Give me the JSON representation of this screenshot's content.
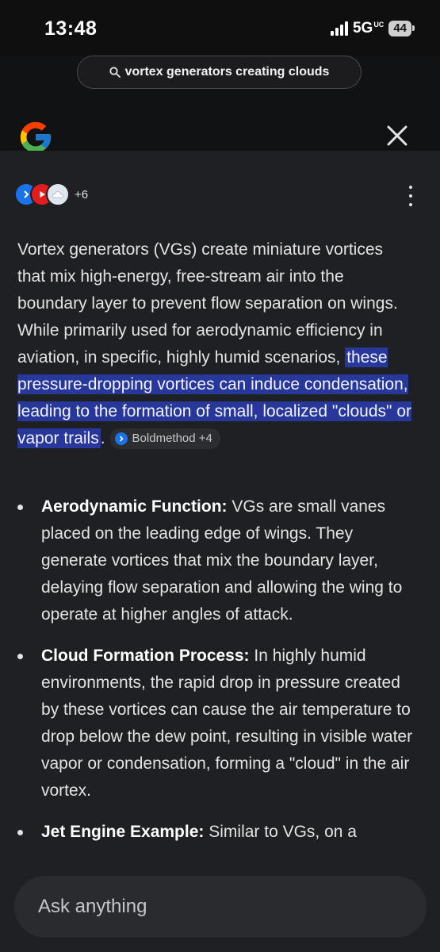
{
  "status_bar": {
    "time": "13:48",
    "network": "5G",
    "network_sub": "UC",
    "battery": "44"
  },
  "search": {
    "query": "vortex generators creating clouds"
  },
  "sources": {
    "more_count": "+6",
    "icons": [
      "boldmethod-icon",
      "youtube-icon",
      "cloud-icon"
    ]
  },
  "answer": {
    "intro": "Vortex generators (VGs) create miniature vortices that mix high-energy, free-stream air into the boundary layer to prevent flow separation on wings. While primarily used for aerodynamic efficiency in aviation, in specific, highly humid scenarios, ",
    "highlight": "these pressure-dropping vortices can induce condensation, leading to the formation of small, localized \"clouds\" or vapor trails",
    "after_highlight": ".",
    "citation": "Boldmethod +4"
  },
  "bullets": [
    {
      "title": "Aerodynamic Function:",
      "text": " VGs are small vanes placed on the leading edge of wings. They generate vortices that mix the boundary layer, delaying flow separation and allowing the wing to operate at higher angles of attack."
    },
    {
      "title": "Cloud Formation Process:",
      "text": " In highly humid environments, the rapid drop in pressure created by these vortices can cause the air temperature to drop below the dew point, resulting in visible water vapor or condensation, forming a \"cloud\" in the air vortex."
    },
    {
      "title": "Jet Engine Example:",
      "text": " Similar to VGs, on a"
    }
  ],
  "ask": {
    "placeholder": "Ask anything"
  },
  "colors": {
    "highlight_bg": "#28389a",
    "background": "#1f2023",
    "header_bg": "#111214"
  }
}
